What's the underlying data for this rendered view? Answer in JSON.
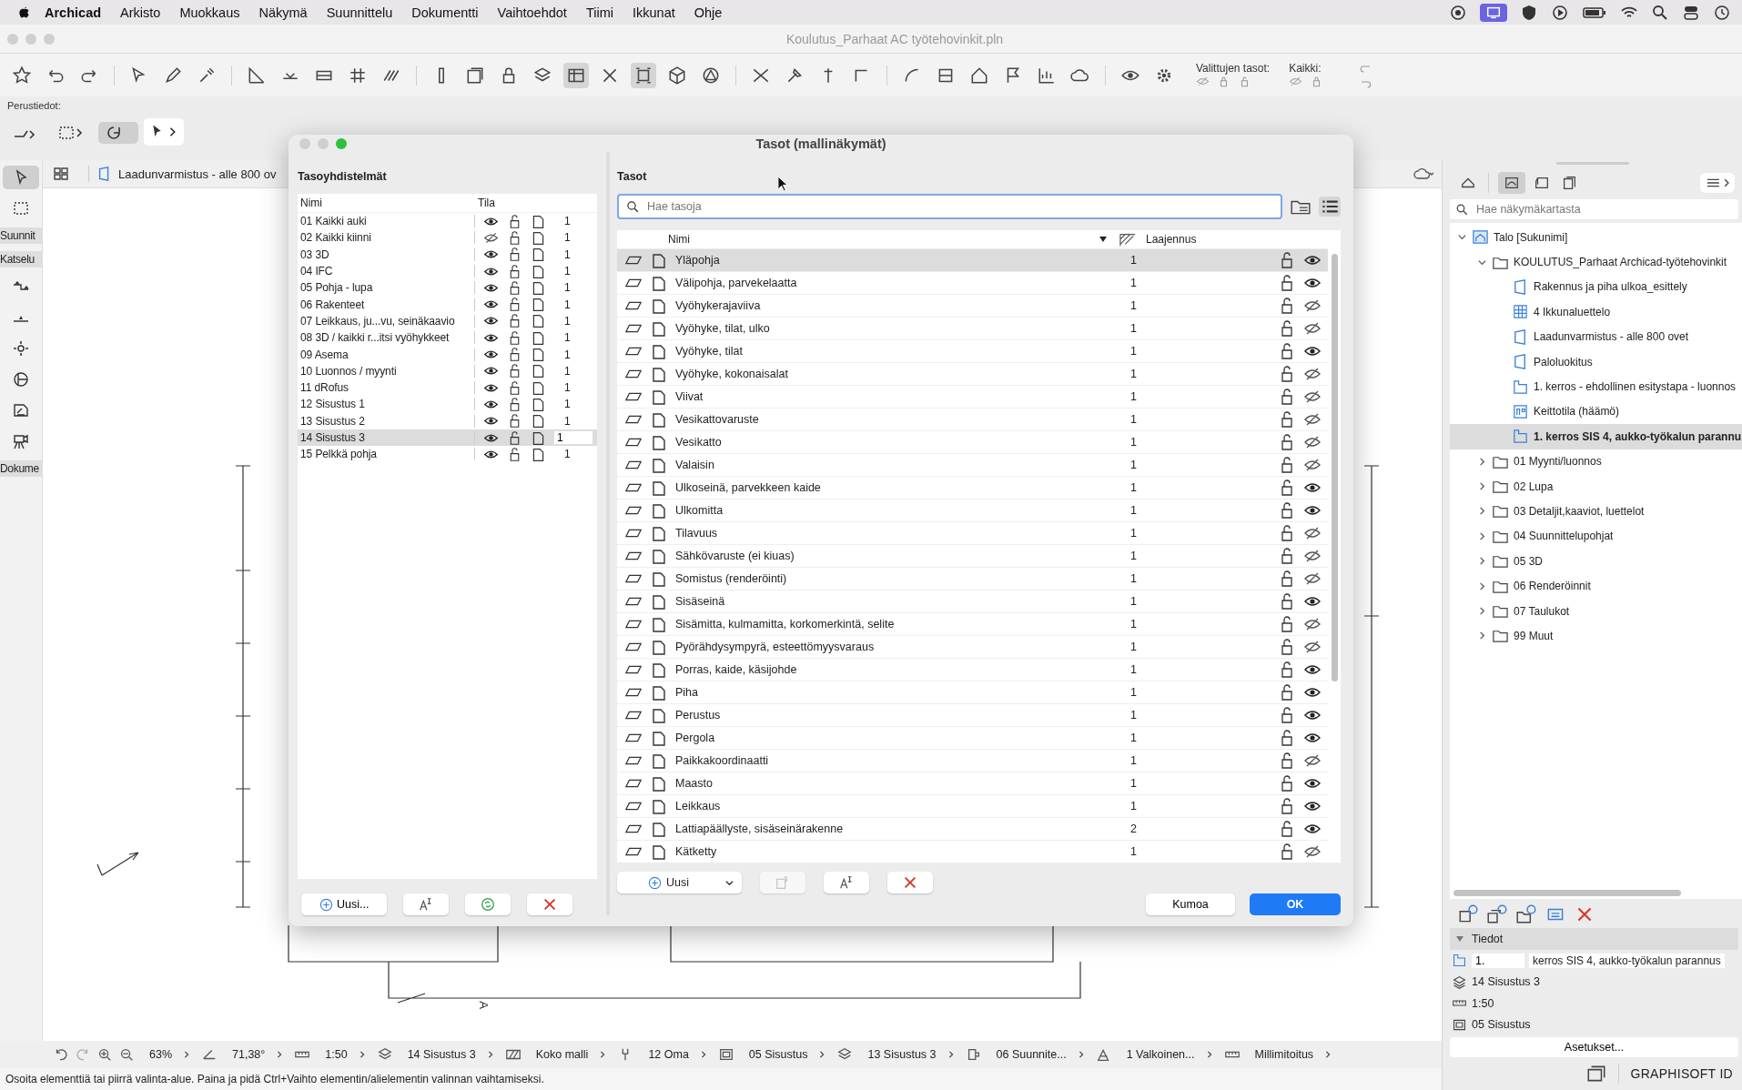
{
  "menu_bar": {
    "app": "Archicad",
    "items": [
      "Arkisto",
      "Muokkaus",
      "Näkymä",
      "Suunnittelu",
      "Dokumentti",
      "Vaihtoehdot",
      "Tiimi",
      "Ikkunat",
      "Ohje"
    ]
  },
  "document_title": "Koulutus_Parhaat AC työtehovinkit.pln",
  "toolbar": {
    "selected_layers_label": "Valittujen tasot:",
    "all_label": "Kaikki:"
  },
  "info_box": {
    "label": "Perustiedot:"
  },
  "toolbox": {
    "groups": [
      "Suunnit",
      "Katselu",
      "Dokume"
    ]
  },
  "view_tab": {
    "label": "Laadunvarmistus - alle 800 ov"
  },
  "drawing": {
    "section_marker": "A"
  },
  "dialog": {
    "title": "Tasot (mallinäkymät)",
    "combinations": {
      "heading": "Tasoyhdistelmät",
      "columns": [
        "Nimi",
        "Tila"
      ],
      "rows": [
        {
          "name": "01 Kaikki auki",
          "visible": true,
          "number": "1",
          "selected": false
        },
        {
          "name": "02 Kaikki kiinni",
          "visible": false,
          "number": "1",
          "selected": false
        },
        {
          "name": "03 3D",
          "visible": true,
          "number": "1",
          "selected": false
        },
        {
          "name": "04 IFC",
          "visible": true,
          "number": "1",
          "selected": false
        },
        {
          "name": "05 Pohja - lupa",
          "visible": true,
          "number": "1",
          "selected": false
        },
        {
          "name": "06 Rakenteet",
          "visible": true,
          "number": "1",
          "selected": false
        },
        {
          "name": "07 Leikkaus, ju...vu, seinäkaavio",
          "visible": true,
          "number": "1",
          "selected": false
        },
        {
          "name": "08 3D / kaikki r...itsi vyöhykkeet",
          "visible": true,
          "number": "1",
          "selected": false
        },
        {
          "name": "09 Asema",
          "visible": true,
          "number": "1",
          "selected": false
        },
        {
          "name": "10 Luonnos / myynti",
          "visible": true,
          "number": "1",
          "selected": false
        },
        {
          "name": "11 dRofus",
          "visible": true,
          "number": "1",
          "selected": false
        },
        {
          "name": "12 Sisustus 1",
          "visible": true,
          "number": "1",
          "selected": false
        },
        {
          "name": "13 Sisustus 2",
          "visible": true,
          "number": "1",
          "selected": false
        },
        {
          "name": "14 Sisustus 3",
          "visible": true,
          "number": "1",
          "selected": true
        },
        {
          "name": "15 Pelkkä pohja",
          "visible": true,
          "number": "1",
          "selected": false
        }
      ],
      "new_button": "Uusi..."
    },
    "layers": {
      "heading": "Tasot",
      "search_placeholder": "Hae tasoja",
      "columns": [
        "Nimi",
        "Laajennus"
      ],
      "rows": [
        {
          "name": "Yläpohja",
          "number": "1",
          "visible": true,
          "selected": true
        },
        {
          "name": "Välipohja, parvekelaatta",
          "number": "1",
          "visible": true,
          "selected": false
        },
        {
          "name": "Vyöhykerajaviiva",
          "number": "1",
          "visible": false,
          "selected": false
        },
        {
          "name": "Vyöhyke, tilat, ulko",
          "number": "1",
          "visible": false,
          "selected": false
        },
        {
          "name": "Vyöhyke, tilat",
          "number": "1",
          "visible": true,
          "selected": false
        },
        {
          "name": "Vyöhyke, kokonaisalat",
          "number": "1",
          "visible": false,
          "selected": false
        },
        {
          "name": "Viivat",
          "number": "1",
          "visible": false,
          "selected": false
        },
        {
          "name": "Vesikattovaruste",
          "number": "1",
          "visible": false,
          "selected": false
        },
        {
          "name": "Vesikatto",
          "number": "1",
          "visible": false,
          "selected": false
        },
        {
          "name": "Valaisin",
          "number": "1",
          "visible": false,
          "selected": false
        },
        {
          "name": "Ulkoseinä, parvekkeen kaide",
          "number": "1",
          "visible": true,
          "selected": false
        },
        {
          "name": "Ulkomitta",
          "number": "1",
          "visible": true,
          "selected": false
        },
        {
          "name": "Tilavuus",
          "number": "1",
          "visible": false,
          "selected": false
        },
        {
          "name": "Sähkövaruste (ei kiuas)",
          "number": "1",
          "visible": false,
          "selected": false
        },
        {
          "name": "Somistus (renderöinti)",
          "number": "1",
          "visible": false,
          "selected": false
        },
        {
          "name": "Sisäseinä",
          "number": "1",
          "visible": true,
          "selected": false
        },
        {
          "name": "Sisämitta, kulmamitta, korkomerkintä, selite",
          "number": "1",
          "visible": false,
          "selected": false
        },
        {
          "name": "Pyörähdysympyrä, esteettömyysvaraus",
          "number": "1",
          "visible": false,
          "selected": false
        },
        {
          "name": "Porras, kaide, käsijohde",
          "number": "1",
          "visible": true,
          "selected": false
        },
        {
          "name": "Piha",
          "number": "1",
          "visible": true,
          "selected": false
        },
        {
          "name": "Perustus",
          "number": "1",
          "visible": true,
          "selected": false
        },
        {
          "name": "Pergola",
          "number": "1",
          "visible": true,
          "selected": false
        },
        {
          "name": "Paikkakoordinaatti",
          "number": "1",
          "visible": false,
          "selected": false
        },
        {
          "name": "Maasto",
          "number": "1",
          "visible": true,
          "selected": false
        },
        {
          "name": "Leikkaus",
          "number": "1",
          "visible": true,
          "selected": false
        },
        {
          "name": "Lattiapäällyste, sisäseinärakenne",
          "number": "2",
          "visible": true,
          "selected": false
        },
        {
          "name": "Kätketty",
          "number": "1",
          "visible": false,
          "selected": false
        }
      ],
      "new_button": "Uusi"
    },
    "cancel_button": "Kumoa",
    "ok_button": "OK"
  },
  "navigator": {
    "search_placeholder": "Hae näkymäkartasta",
    "tree": [
      {
        "label": "Talo [Sukunimi]",
        "kind": "project",
        "expanded": true,
        "selected": false,
        "children": [
          {
            "label": "KOULUTUS_Parhaat Archicad-työtehovinkit",
            "kind": "folder",
            "expanded": true,
            "selected": false,
            "children": [
              {
                "label": "Rakennus ja piha ulkoa_esittely",
                "kind": "view3d",
                "selected": false
              },
              {
                "label": "4 Ikkunaluettelo",
                "kind": "schedule",
                "selected": false
              },
              {
                "label": "Laadunvarmistus - alle 800 ovet",
                "kind": "view3d",
                "selected": false
              },
              {
                "label": "Paloluokitus",
                "kind": "view3d",
                "selected": false
              },
              {
                "label": "1. kerros - ehdollinen esitystapa - luonnos",
                "kind": "plan",
                "selected": false
              },
              {
                "label": "Keittotila (häämö)",
                "kind": "elevation",
                "selected": false
              },
              {
                "label": "1. kerros SIS 4, aukko-työkalun parannu",
                "kind": "plan",
                "selected": true
              }
            ]
          },
          {
            "label": "01 Myynti/luonnos",
            "kind": "folder",
            "expanded": false,
            "selected": false
          },
          {
            "label": "02 Lupa",
            "kind": "folder",
            "expanded": false,
            "selected": false
          },
          {
            "label": "03 Detaljit,kaaviot, luettelot",
            "kind": "folder",
            "expanded": false,
            "selected": false
          },
          {
            "label": "04 Suunnittelupohjat",
            "kind": "folder",
            "expanded": false,
            "selected": false
          },
          {
            "label": "05 3D",
            "kind": "folder",
            "expanded": false,
            "selected": false
          },
          {
            "label": "06 Renderöinnit",
            "kind": "folder",
            "expanded": false,
            "selected": false
          },
          {
            "label": "07 Taulukot",
            "kind": "folder",
            "expanded": false,
            "selected": false
          },
          {
            "label": "99 Muut",
            "kind": "folder",
            "expanded": false,
            "selected": false
          }
        ]
      }
    ]
  },
  "details": {
    "heading": "Tiedot",
    "id": "1.",
    "name": "kerros SIS 4, aukko-työkalun parannus",
    "layer_combination": "14 Sisustus 3",
    "scale": "1:50",
    "model_view": "05 Sisustus",
    "settings_button": "Asetukset..."
  },
  "status_bar": {
    "items": [
      "63%",
      "71,38°",
      "1:50",
      "14 Sisustus 3",
      "Koko malli",
      "12 Oma",
      "05 Sisustus",
      "13 Sisustus 3",
      "06 Suunnite...",
      "1 Valkoinen...",
      "Millimitoitus"
    ],
    "message": "Osoita elementtiä tai piirrä valinta-alue. Paina ja pidä Ctrl+Vaihto elementin/alielementin valinnan vaihtamiseksi."
  },
  "footer": {
    "brand": "GRAPHISOFT ID"
  }
}
